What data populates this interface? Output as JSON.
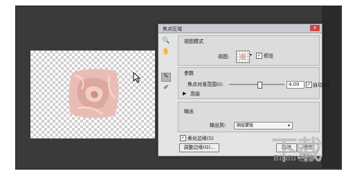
{
  "dialog": {
    "title": "焦点区域",
    "close_label": "x",
    "view_mode": {
      "heading": "视图模式",
      "view_label": "视图:",
      "preview_label": "预览",
      "preview_checked": true
    },
    "params": {
      "heading": "参数",
      "focus_range_label": "焦点对准范围(I):",
      "focus_range_value": "4.00",
      "focus_range_fraction": 0.55,
      "auto_label": "自动(A)",
      "auto_checked": true,
      "advanced_label": "高级"
    },
    "output": {
      "heading": "输出",
      "output_to_label": "输出到:",
      "output_to_value": "图层蒙版"
    },
    "soften_edges_label": "柔化边缘(S)",
    "soften_edges_checked": true,
    "refine_edge_button": "调整边缘(G)...",
    "cancel_button": "取消",
    "ok_button": "确定"
  },
  "tools": [
    {
      "name": "zoom-tool-icon",
      "glyph": "🔍"
    },
    {
      "name": "hand-tool-icon",
      "glyph": "✋"
    },
    {
      "name": "focus-area-add-tool-icon",
      "glyph": "✎"
    },
    {
      "name": "focus-area-subtract-tool-icon",
      "glyph": "✐"
    }
  ],
  "watermark": {
    "logo_text": "下载",
    "sub_text": "Bitdu 经验"
  },
  "colors": {
    "canvas_bg": "#3a3a3a",
    "dialog_bg": "#e4e4e4",
    "rose": "#e6b3aa"
  }
}
